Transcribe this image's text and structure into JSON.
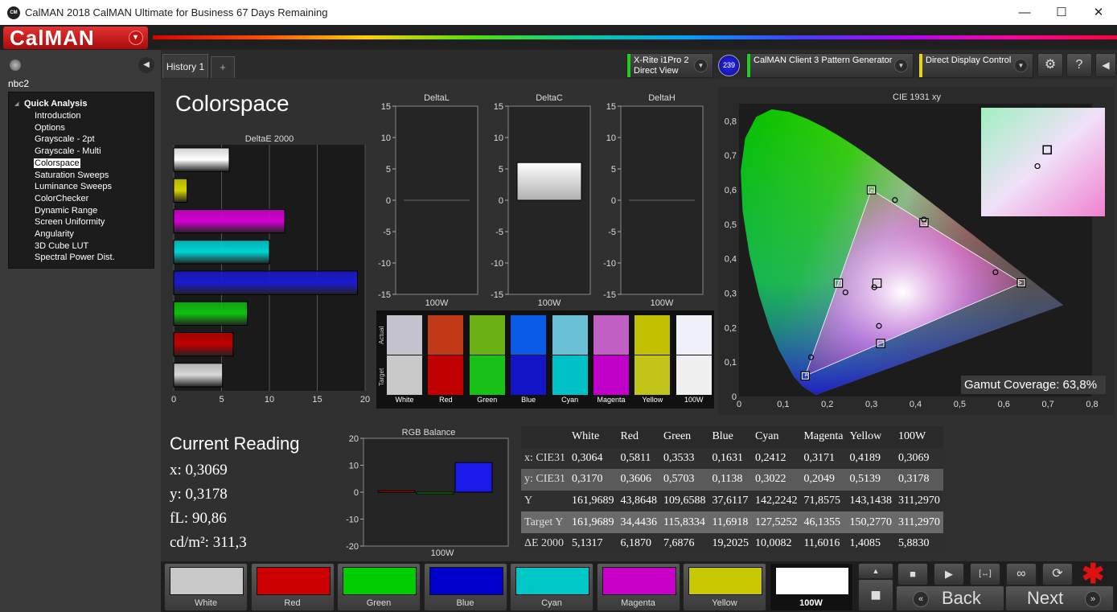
{
  "window": {
    "title": "CalMAN 2018 CalMAN Ultimate for Business 67 Days Remaining",
    "icon_text": "CM",
    "minimize": "—",
    "maximize": "☐",
    "close": "✕"
  },
  "brand": {
    "logo": "CalMAN",
    "logo_arrow": "▾"
  },
  "sidebar": {
    "name": "nbc2",
    "root": "Quick Analysis",
    "items": [
      "Introduction",
      "Options",
      "Grayscale - 2pt",
      "Grayscale - Multi",
      "Colorspace",
      "Saturation Sweeps",
      "Luminance Sweeps",
      "ColorChecker",
      "Dynamic Range",
      "Screen Uniformity",
      "Angularity",
      "3D Cube LUT",
      "Spectral Power Dist."
    ],
    "selected": "Colorspace"
  },
  "tabs": {
    "history": "History 1",
    "add": "+"
  },
  "devices": {
    "meter_line1": "X-Rite i1Pro 2",
    "meter_line2": "Direct View",
    "meter_badge": "239",
    "generator": "CalMAN Client 3 Pattern Generator",
    "display": "Direct Display Control",
    "settings_icon": "⚙",
    "help_icon": "?",
    "collapse_icon": "◀"
  },
  "page": {
    "title": "Colorspace"
  },
  "current_reading": {
    "title": "Current Reading",
    "x": "x: 0,3069",
    "y": "y: 0,3178",
    "fl": "fL: 90,86",
    "cdm2": "cd/m²: 311,3"
  },
  "swatch_panel": {
    "actual": "Actual",
    "target": "Target"
  },
  "chart_data": [
    {
      "type": "bar",
      "title": "DeltaE 2000",
      "orientation": "horizontal",
      "categories": [
        "White",
        "Yellow",
        "Magenta",
        "Cyan",
        "Blue",
        "Green",
        "Red",
        "100W"
      ],
      "values": [
        5.8,
        1.4,
        11.6,
        10.0,
        19.2,
        7.7,
        6.2,
        5.1
      ],
      "colors": [
        "#ffffff",
        "#d4d400",
        "#d400d4",
        "#00d4d4",
        "#1a1ad0",
        "#10c010",
        "#c00000",
        "#d8d8d8"
      ],
      "xlim": [
        0,
        20
      ],
      "ticks": [
        "0",
        "5",
        "10",
        "15",
        "20"
      ]
    },
    {
      "type": "bar",
      "title": "DeltaL",
      "categories": [
        "100W"
      ],
      "values": [
        0
      ],
      "ylim": [
        -15,
        15
      ],
      "ticks": [
        "15",
        "10",
        "5",
        "0",
        "-5",
        "-10",
        "-15"
      ]
    },
    {
      "type": "bar",
      "title": "DeltaC",
      "categories": [
        "100W"
      ],
      "values": [
        6
      ],
      "ylim": [
        -15,
        15
      ],
      "ticks": [
        "15",
        "10",
        "5",
        "0",
        "-5",
        "-10",
        "-15"
      ]
    },
    {
      "type": "bar",
      "title": "DeltaH",
      "categories": [
        "100W"
      ],
      "values": [
        0
      ],
      "ylim": [
        -15,
        15
      ],
      "ticks": [
        "15",
        "10",
        "5",
        "0",
        "-5",
        "-10",
        "-15"
      ]
    },
    {
      "type": "bar",
      "title": "RGB Balance",
      "categories": [
        "100W"
      ],
      "series": [
        {
          "values": [
            0.5
          ],
          "color": "#c00000"
        },
        {
          "values": [
            -0.5
          ],
          "color": "#10a010"
        },
        {
          "values": [
            11
          ],
          "color": "#1a1ae8"
        }
      ],
      "ylim": [
        -20,
        20
      ],
      "ticks": [
        "20",
        "10",
        "0",
        "-10",
        "-20"
      ]
    },
    {
      "type": "scatter",
      "title": "CIE 1931 xy",
      "xlim": [
        0,
        0.8
      ],
      "ylim": [
        0,
        0.85
      ],
      "xticks": [
        "0",
        "0,1",
        "0,2",
        "0,3",
        "0,4",
        "0,5",
        "0,6",
        "0,7",
        "0,8"
      ],
      "yticks": [
        "0",
        "0,1",
        "0,2",
        "0,3",
        "0,4",
        "0,5",
        "0,6",
        "0,7",
        "0,8"
      ],
      "targets": [
        {
          "name": "Red",
          "x": 0.64,
          "y": 0.33
        },
        {
          "name": "Green",
          "x": 0.3,
          "y": 0.6
        },
        {
          "name": "Blue",
          "x": 0.15,
          "y": 0.06
        },
        {
          "name": "Cyan",
          "x": 0.225,
          "y": 0.329
        },
        {
          "name": "Magenta",
          "x": 0.321,
          "y": 0.154
        },
        {
          "name": "Yellow",
          "x": 0.419,
          "y": 0.505
        },
        {
          "name": "White",
          "x": 0.3127,
          "y": 0.329
        }
      ],
      "actual": [
        {
          "name": "Red",
          "x": 0.5811,
          "y": 0.3606
        },
        {
          "name": "Green",
          "x": 0.3533,
          "y": 0.5703
        },
        {
          "name": "Blue",
          "x": 0.1631,
          "y": 0.1138
        },
        {
          "name": "Cyan",
          "x": 0.2412,
          "y": 0.3022
        },
        {
          "name": "Magenta",
          "x": 0.3171,
          "y": 0.2049
        },
        {
          "name": "Yellow",
          "x": 0.4189,
          "y": 0.5139
        },
        {
          "name": "White",
          "x": 0.3064,
          "y": 0.317
        }
      ],
      "inset": {
        "target": {
          "x": 0.3127,
          "y": 0.329
        },
        "actual": {
          "x": 0.3064,
          "y": 0.317
        }
      },
      "gamut_coverage": "Gamut Coverage:  63,8%"
    }
  ],
  "chart_labels": {
    "deltae_x": "",
    "deltal_x": "100W",
    "deltac_x": "100W",
    "deltah_x": "100W",
    "rgb_x": "100W"
  },
  "swatches": [
    {
      "label": "White",
      "actual": "#c4c2cc",
      "target": "#c8c8c8"
    },
    {
      "label": "Red",
      "actual": "#c03a18",
      "target": "#c00000"
    },
    {
      "label": "Green",
      "actual": "#6ab014",
      "target": "#18c018"
    },
    {
      "label": "Blue",
      "actual": "#0a5ae8",
      "target": "#1414c8"
    },
    {
      "label": "Cyan",
      "actual": "#6ac0d4",
      "target": "#00c0c8"
    },
    {
      "label": "Magenta",
      "actual": "#c060c4",
      "target": "#c000c8"
    },
    {
      "label": "Yellow",
      "actual": "#c0c000",
      "target": "#c4c418"
    },
    {
      "label": "100W",
      "actual": "#f0f0f8",
      "target": "#f0f0f0"
    }
  ],
  "table": {
    "headers": [
      "",
      "White",
      "Red",
      "Green",
      "Blue",
      "Cyan",
      "Magenta",
      "Yellow",
      "100W"
    ],
    "rows": [
      [
        "x: CIE31",
        "0,3064",
        "0,5811",
        "0,3533",
        "0,1631",
        "0,2412",
        "0,3171",
        "0,4189",
        "0,3069"
      ],
      [
        "y: CIE31",
        "0,3170",
        "0,3606",
        "0,5703",
        "0,1138",
        "0,3022",
        "0,2049",
        "0,5139",
        "0,3178"
      ],
      [
        "Y",
        "161,9689",
        "43,8648",
        "109,6588",
        "37,6117",
        "142,2242",
        "71,8575",
        "143,1438",
        "311,2970"
      ],
      [
        "Target Y",
        "161,9689",
        "34,4436",
        "115,8334",
        "11,6918",
        "127,5252",
        "46,1355",
        "150,2770",
        "311,2970"
      ],
      [
        "ΔE 2000",
        "5,1317",
        "6,1870",
        "7,6876",
        "19,2025",
        "10,0082",
        "11,6016",
        "1,4085",
        "5,8830"
      ]
    ]
  },
  "patches": [
    {
      "label": "White",
      "color": "#c8c8c8"
    },
    {
      "label": "Red",
      "color": "#cc0000"
    },
    {
      "label": "Green",
      "color": "#00cc00"
    },
    {
      "label": "Blue",
      "color": "#0000cc"
    },
    {
      "label": "Cyan",
      "color": "#00c8c8"
    },
    {
      "label": "Magenta",
      "color": "#c800c8"
    },
    {
      "label": "Yellow",
      "color": "#c8c800"
    },
    {
      "label": "100W",
      "color": "#ffffff"
    }
  ],
  "controls": {
    "up": "▲",
    "stop_big": "■",
    "stop": "■",
    "play": "▶",
    "bracket": "[↔]",
    "loop": "∞",
    "refresh": "⟳",
    "star": "✱"
  },
  "nav": {
    "back": "Back",
    "next": "Next",
    "back_icon": "«",
    "next_icon": "»"
  }
}
